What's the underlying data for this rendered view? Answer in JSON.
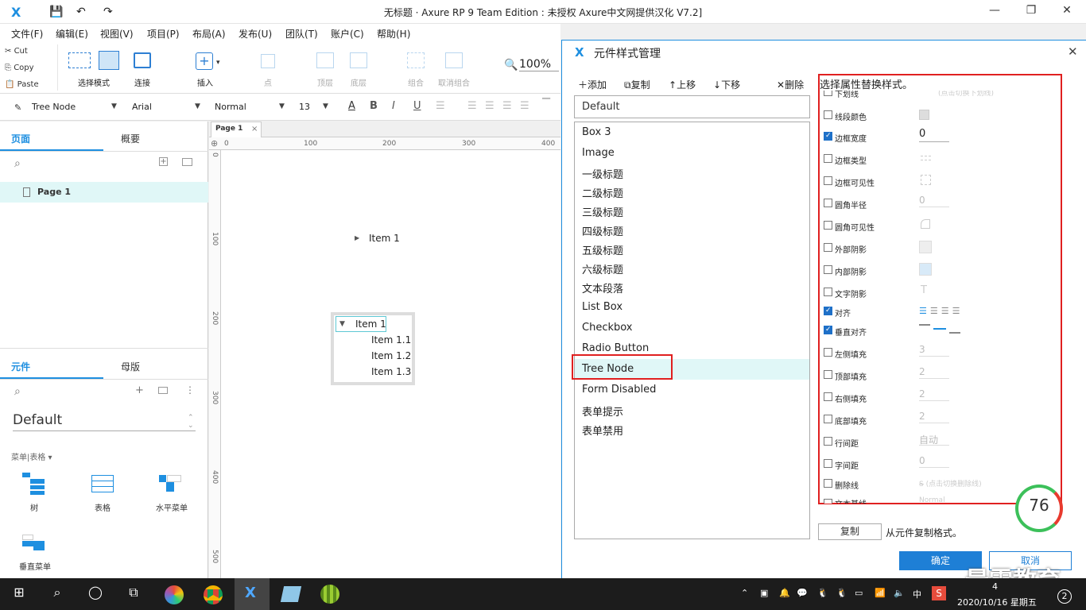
{
  "window": {
    "title": "无标题 · Axure RP 9 Team Edition : 未授权    Axure中文网提供汉化 V7.2]",
    "minimize": "—",
    "maximize": "❐",
    "close": "✕"
  },
  "quickaccess": {
    "save": "💾",
    "undo": "↶",
    "redo": "↷"
  },
  "menu": [
    "文件(F)",
    "编辑(E)",
    "视图(V)",
    "项目(P)",
    "布局(A)",
    "发布(U)",
    "团队(T)",
    "账户(C)",
    "帮助(H)"
  ],
  "clipboard": {
    "cut": "Cut",
    "copy": "Copy",
    "paste": "Paste"
  },
  "toolbar": {
    "select_mode": "选择模式",
    "connect": "连接",
    "insert": "插入",
    "point": "点",
    "top": "顶层",
    "bottom": "底层",
    "group": "组合",
    "ungroup": "取消组合",
    "zoom": "100%"
  },
  "format": {
    "style": "Tree Node",
    "font": "Arial",
    "weight": "Normal",
    "size": "13"
  },
  "left": {
    "pages_tab": "页面",
    "outline_tab": "概要",
    "page_item": "Page 1",
    "widgets_tab": "元件",
    "masters_tab": "母版",
    "library": "Default",
    "category": "菜单|表格 ▾",
    "widgets": [
      {
        "label": "树"
      },
      {
        "label": "表格"
      },
      {
        "label": "水平菜单"
      },
      {
        "label": "垂直菜单"
      }
    ]
  },
  "canvas": {
    "tab": "Page 1",
    "ruler_h": [
      "0",
      "100",
      "200",
      "300",
      "400"
    ],
    "ruler_v": [
      "0",
      "100",
      "200",
      "300",
      "400",
      "500"
    ],
    "collapsed_node": "Item 1",
    "tree_root": "Item 1",
    "tree_children": [
      "Item 1.1",
      "Item 1.2",
      "Item 1.3"
    ]
  },
  "dialog": {
    "title": "元件样式管理",
    "actions": {
      "add": "添加",
      "copy": "复制",
      "up": "上移",
      "down": "下移",
      "delete": "删除"
    },
    "default_style": "Default",
    "styles": [
      "Box 3",
      "Image",
      "一级标题",
      "二级标题",
      "三级标题",
      "四级标题",
      "五级标题",
      "六级标题",
      "文本段落",
      "List Box",
      "Checkbox",
      "Radio Button",
      "Tree Node",
      "Form Disabled",
      "表单提示",
      "表单禁用"
    ],
    "selected_style": "Tree Node",
    "prop_heading": "选择属性替换样式。",
    "props": [
      {
        "label": "下划线",
        "checked": false,
        "value": "(点击切换下划线)"
      },
      {
        "label": "线段颜色",
        "checked": false,
        "value": ""
      },
      {
        "label": "边框宽度",
        "checked": true,
        "value": "0"
      },
      {
        "label": "边框类型",
        "checked": false,
        "value": ""
      },
      {
        "label": "边框可见性",
        "checked": false,
        "value": ""
      },
      {
        "label": "圆角半径",
        "checked": false,
        "value": "0"
      },
      {
        "label": "圆角可见性",
        "checked": false,
        "value": ""
      },
      {
        "label": "外部阴影",
        "checked": false,
        "value": ""
      },
      {
        "label": "内部阴影",
        "checked": false,
        "value": ""
      },
      {
        "label": "文字阴影",
        "checked": false,
        "value": "T"
      },
      {
        "label": "对齐",
        "checked": true,
        "value": ""
      },
      {
        "label": "垂直对齐",
        "checked": true,
        "value": ""
      },
      {
        "label": "左侧填充",
        "checked": false,
        "value": "3"
      },
      {
        "label": "顶部填充",
        "checked": false,
        "value": "2"
      },
      {
        "label": "右侧填充",
        "checked": false,
        "value": "2"
      },
      {
        "label": "底部填充",
        "checked": false,
        "value": "2"
      },
      {
        "label": "行间距",
        "checked": false,
        "value": "自动"
      },
      {
        "label": "字间距",
        "checked": false,
        "value": "0"
      },
      {
        "label": "删除线",
        "checked": false,
        "value": "(点击切换删除线)"
      },
      {
        "label": "文本基线",
        "checked": false,
        "value": "Normal"
      }
    ],
    "copy_btn": "复制",
    "copy_hint": "从元件复制格式。",
    "ok": "确定",
    "cancel": "取消"
  },
  "overlay": {
    "gauge": "76",
    "watermark": "最需教育"
  },
  "taskbar": {
    "ime": "中",
    "time": "4",
    "date": "2020/10/16 星期五",
    "notif": "2"
  },
  "colors": {
    "accent": "#1e8fe0",
    "highlight_red": "#e02020",
    "selected_row": "#e0f7f7",
    "ok_button": "#1e7fd6"
  }
}
